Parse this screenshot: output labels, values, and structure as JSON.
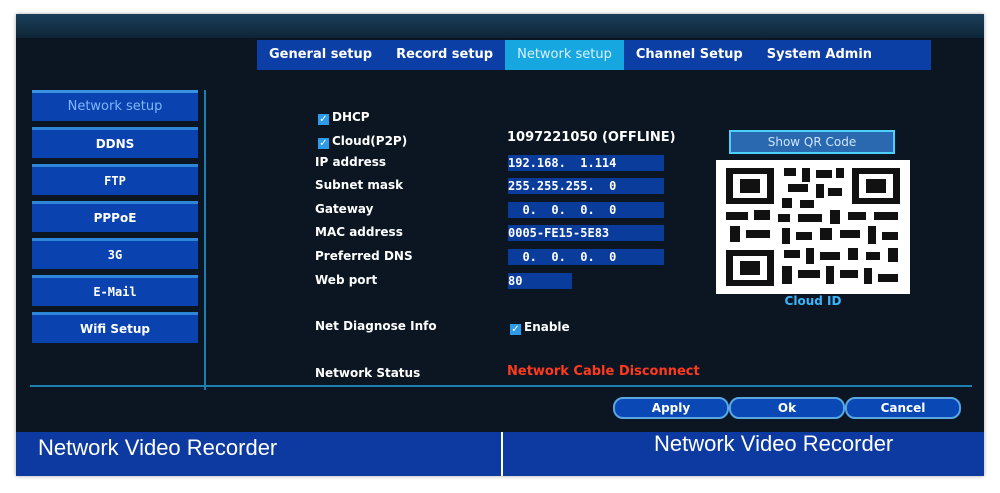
{
  "tabs": [
    {
      "label": "General setup"
    },
    {
      "label": "Record setup"
    },
    {
      "label": "Network setup"
    },
    {
      "label": "Channel Setup"
    },
    {
      "label": "System Admin"
    }
  ],
  "sidebar": {
    "items": [
      {
        "label": "Network setup"
      },
      {
        "label": "DDNS"
      },
      {
        "label": "FTP"
      },
      {
        "label": "PPPoE"
      },
      {
        "label": "3G"
      },
      {
        "label": "E-Mail"
      },
      {
        "label": "Wifi Setup"
      }
    ]
  },
  "form": {
    "dhcp": {
      "label": "DHCP",
      "checked": true
    },
    "cloud": {
      "label": "Cloud(P2P)",
      "checked": true,
      "value": "1097221050  (OFFLINE)"
    },
    "ip": {
      "label": "IP address",
      "value": "192.168.  1.114"
    },
    "subnet": {
      "label": "Subnet mask",
      "value": "255.255.255.  0"
    },
    "gateway": {
      "label": "Gateway",
      "value": "  0.  0.  0.  0"
    },
    "mac": {
      "label": "MAC address",
      "value": "0005-FE15-5E83"
    },
    "dns": {
      "label": "Preferred DNS",
      "value": "  0.  0.  0.  0"
    },
    "webport": {
      "label": "Web port",
      "value": "80"
    },
    "diagnose": {
      "label": "Net Diagnose Info",
      "check_label": "Enable",
      "checked": true
    },
    "status": {
      "label": "Network Status",
      "value": "Network Cable Disconnect"
    }
  },
  "qr": {
    "button_label": "Show QR Code",
    "caption": "Cloud ID"
  },
  "buttons": {
    "apply": "Apply",
    "ok": "Ok",
    "cancel": "Cancel"
  },
  "footer": {
    "left_title": "Network Video Recorder",
    "right_title": "Network Video Recorder"
  },
  "colors": {
    "tab_bar": "#0b3fa5",
    "active_tab": "#17a7e0",
    "status_error": "#ff3a1f",
    "background": "#0b1622"
  }
}
